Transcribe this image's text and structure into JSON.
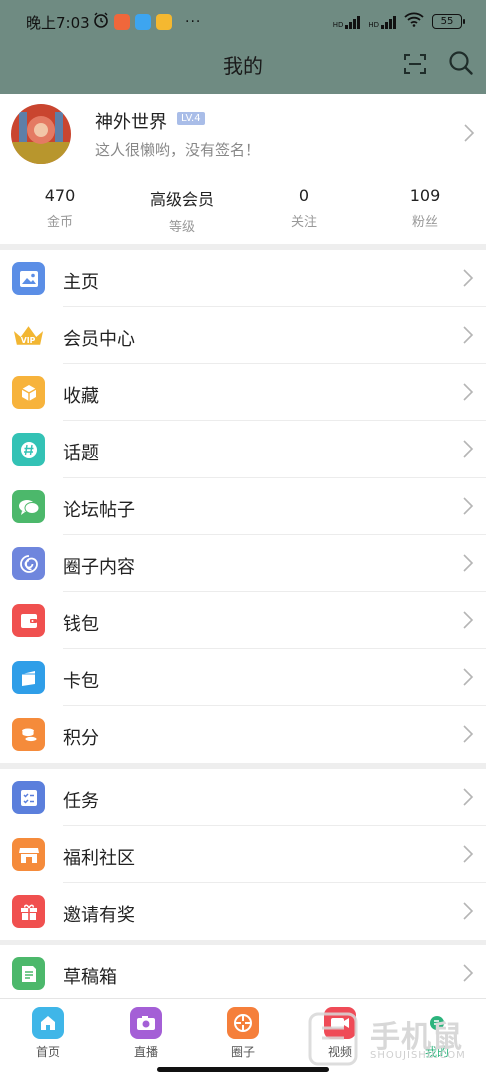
{
  "status": {
    "time": "晚上7:03",
    "battery": "55",
    "net1": "HD",
    "net2": "HD"
  },
  "header": {
    "title": "我的"
  },
  "profile": {
    "name": "神外世界",
    "level": "LV.4",
    "signature": "这人很懒哟，没有签名！",
    "stats": [
      {
        "value": "470",
        "label": "金币"
      },
      {
        "value": "高级会员",
        "label": "等级"
      },
      {
        "value": "0",
        "label": "关注"
      },
      {
        "value": "109",
        "label": "粉丝"
      }
    ]
  },
  "menu_group1": [
    {
      "label": "主页",
      "icon": "image-icon",
      "color": "#5b8ee6"
    },
    {
      "label": "会员中心",
      "icon": "crown-icon",
      "color": "#f2b632"
    },
    {
      "label": "收藏",
      "icon": "box-icon",
      "color": "#f7b33c"
    },
    {
      "label": "话题",
      "icon": "hashtag-icon",
      "color": "#33c2b5"
    },
    {
      "label": "论坛帖子",
      "icon": "chat-icon",
      "color": "#4cb86b"
    },
    {
      "label": "圈子内容",
      "icon": "swirl-icon",
      "color": "#6f86dd"
    },
    {
      "label": "钱包",
      "icon": "wallet-icon",
      "color": "#f0504f"
    },
    {
      "label": "卡包",
      "icon": "card-icon",
      "color": "#2f9ee8"
    },
    {
      "label": "积分",
      "icon": "coins-icon",
      "color": "#f58b3b"
    }
  ],
  "menu_group2": [
    {
      "label": "任务",
      "icon": "task-icon",
      "color": "#5b7fdc"
    },
    {
      "label": "福利社区",
      "icon": "store-icon",
      "color": "#f58b3b"
    },
    {
      "label": "邀请有奖",
      "icon": "gift-icon",
      "color": "#f0504f"
    }
  ],
  "menu_group3": [
    {
      "label": "草稿箱",
      "icon": "draft-icon",
      "color": "#4cb86b"
    }
  ],
  "tabs": [
    {
      "label": "首页",
      "icon": "home-icon",
      "color": "#3fb6e8"
    },
    {
      "label": "直播",
      "icon": "camera-icon",
      "color": "#a45fd6"
    },
    {
      "label": "圈子",
      "icon": "aperture-icon",
      "color": "#f57f3b"
    },
    {
      "label": "视频",
      "icon": "video-icon",
      "color": "#ef4b57"
    },
    {
      "label": "我的",
      "icon": "profile-tab-icon",
      "color": "#2bb37c"
    }
  ],
  "watermark": {
    "text": "手机鼠",
    "url": "SHOUJISHU.COM"
  }
}
